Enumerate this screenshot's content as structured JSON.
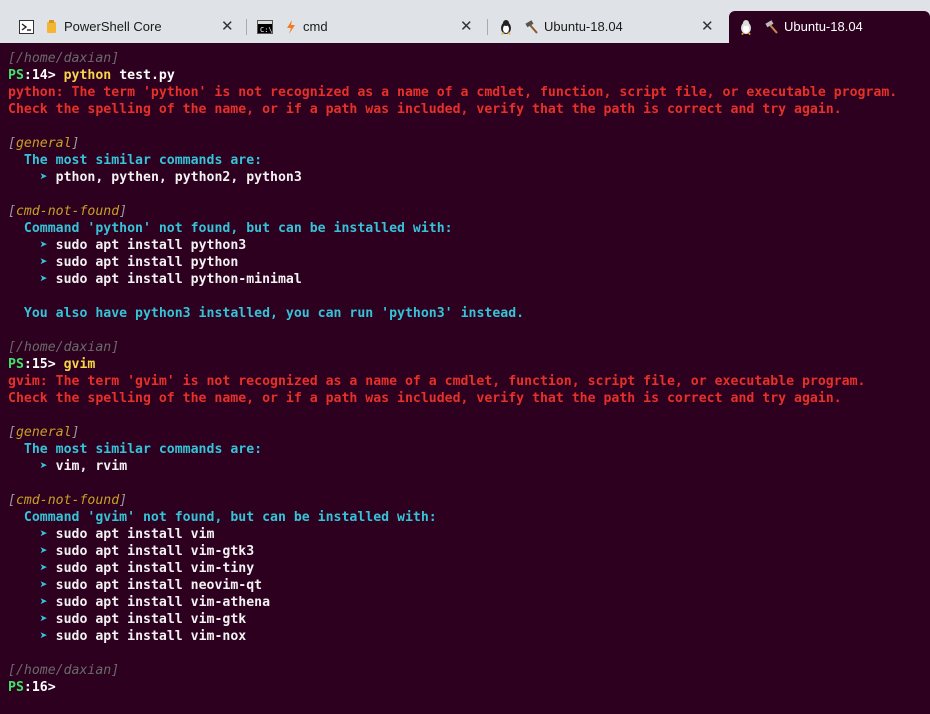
{
  "tabs": [
    {
      "icon": "powershell-icon",
      "label": "PowerShell Core",
      "close": "✕"
    },
    {
      "icon": "cmd-icon",
      "label": "cmd",
      "close": "✕"
    },
    {
      "icon": "ubuntu-icon",
      "label": "Ubuntu-18.04",
      "close": "✕"
    },
    {
      "icon": "ubuntu-icon",
      "label": "Ubuntu-18.04"
    }
  ],
  "terminal": {
    "cwd": "[/home/daxian]",
    "prompt_ps": "PS",
    "blocks": [
      {
        "prompt_num": ":14>",
        "command": "python",
        "args": " test.py",
        "error_lines": [
          "python: The term 'python' is not recognized as a name of a cmdlet, function, script file, or executable program.",
          "Check the spelling of the name, or if a path was included, verify that the path is correct and try again."
        ],
        "general_label": "general",
        "similar_heading": "The most similar commands are:",
        "similar": "pthon, pythen, python2, python3",
        "cnf_label": "cmd-not-found",
        "cnf_heading": "Command 'python' not found, but can be installed with:",
        "installs": [
          "sudo apt install python3",
          "sudo apt install python",
          "sudo apt install python-minimal"
        ],
        "note": "You also have python3 installed, you can run 'python3' instead."
      },
      {
        "prompt_num": ":15>",
        "command": "gvim",
        "error_lines": [
          "gvim: The term 'gvim' is not recognized as a name of a cmdlet, function, script file, or executable program.",
          "Check the spelling of the name, or if a path was included, verify that the path is correct and try again."
        ],
        "general_label": "general",
        "similar_heading": "The most similar commands are:",
        "similar": "vim, rvim",
        "cnf_label": "cmd-not-found",
        "cnf_heading": "Command 'gvim' not found, but can be installed with:",
        "installs": [
          "sudo apt install vim",
          "sudo apt install vim-gtk3",
          "sudo apt install vim-tiny",
          "sudo apt install neovim-qt",
          "sudo apt install vim-athena",
          "sudo apt install vim-gtk",
          "sudo apt install vim-nox"
        ]
      }
    ],
    "final_prompt_num": ":16>",
    "arrow": "➤"
  },
  "colors": {
    "background": "#2c001e",
    "prompt_green": "#3fe36a",
    "error_red": "#e6302a",
    "accent_cyan": "#36c3d8",
    "section_gold": "#c6a024",
    "command_yellow": "#f6d54a"
  }
}
